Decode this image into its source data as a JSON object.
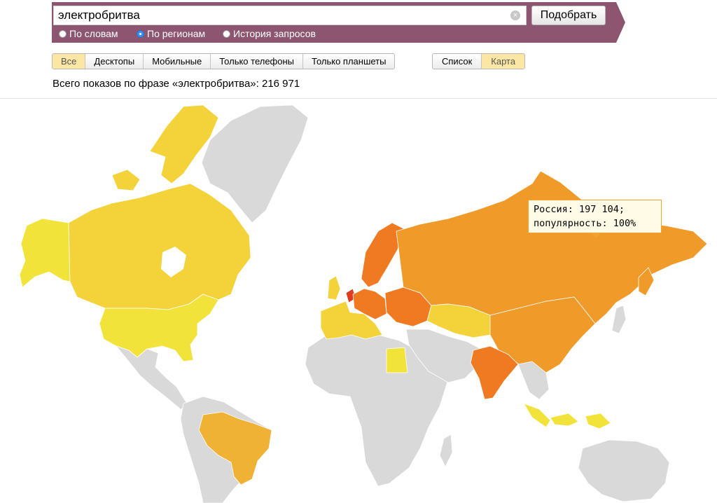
{
  "search": {
    "query": "электробритва",
    "submit_label": "Подобрать",
    "clear_glyph": "×",
    "modes": [
      {
        "label": "По словам",
        "checked": false
      },
      {
        "label": "По регионам",
        "checked": true
      },
      {
        "label": "История запросов",
        "checked": false
      }
    ]
  },
  "devices": {
    "tabs": [
      {
        "label": "Все",
        "active": true
      },
      {
        "label": "Десктопы",
        "active": false
      },
      {
        "label": "Мобильные",
        "active": false
      },
      {
        "label": "Только телефоны",
        "active": false
      },
      {
        "label": "Только планшеты",
        "active": false
      }
    ]
  },
  "view": {
    "tabs": [
      {
        "label": "Список",
        "active": false
      },
      {
        "label": "Карта",
        "active": true
      }
    ]
  },
  "summary": "Всего показов по фразе «электробритва»: 216 971",
  "tooltip": {
    "line1": "Россия: 197 104;",
    "line2": "популярность: 100%"
  },
  "colors": {
    "band": "#8e5570",
    "no_data": "#d9d9d9",
    "tooltip_border": "#f0a330",
    "active_tab": "#fbe6a4",
    "scale": {
      "very_low": "#f2e33a",
      "low": "#f3d23a",
      "medium": "#f0b235",
      "high": "#f09a2a",
      "higher": "#ef7a22",
      "top": "#e03a1c"
    }
  },
  "map": {
    "regions": [
      {
        "id": "greenland",
        "level": "no_data"
      },
      {
        "id": "alaska",
        "level": "very_low"
      },
      {
        "id": "canada",
        "level": "low"
      },
      {
        "id": "usa",
        "level": "very_low"
      },
      {
        "id": "mexico-central-america",
        "level": "no_data"
      },
      {
        "id": "south-america",
        "level": "no_data"
      },
      {
        "id": "brazil",
        "level": "medium"
      },
      {
        "id": "africa",
        "level": "no_data"
      },
      {
        "id": "egypt",
        "level": "very_low"
      },
      {
        "id": "western-europe",
        "level": "low"
      },
      {
        "id": "netherlands",
        "level": "top"
      },
      {
        "id": "germany",
        "level": "higher"
      },
      {
        "id": "scandinavia",
        "level": "higher"
      },
      {
        "id": "ukraine",
        "level": "higher"
      },
      {
        "id": "russia",
        "level": "high"
      },
      {
        "id": "kazakhstan",
        "level": "low"
      },
      {
        "id": "middle-east",
        "level": "no_data"
      },
      {
        "id": "china",
        "level": "high"
      },
      {
        "id": "india",
        "level": "higher"
      },
      {
        "id": "indonesia",
        "level": "very_low"
      },
      {
        "id": "australia",
        "level": "no_data"
      }
    ]
  }
}
